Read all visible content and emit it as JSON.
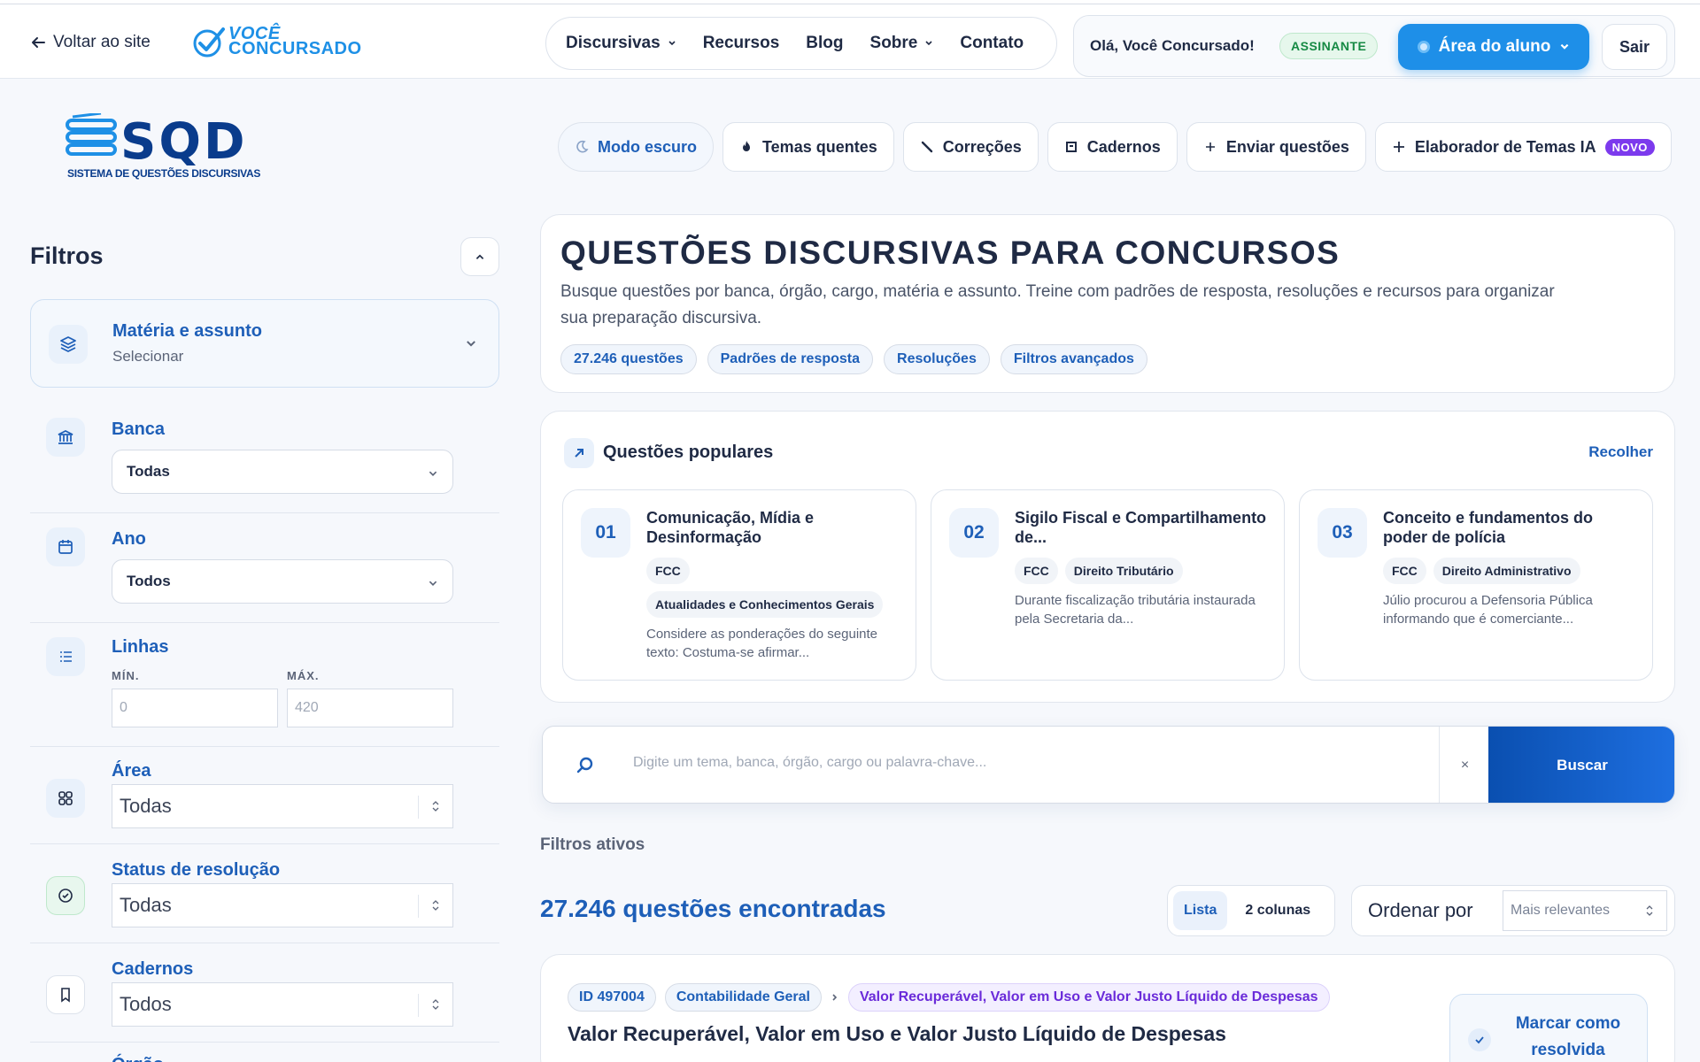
{
  "header": {
    "back_label": "Voltar ao site",
    "logo_line1": "VOCÊ",
    "logo_line2": "CONCURSADO",
    "nav": [
      {
        "label": "Discursivas",
        "has_dropdown": true
      },
      {
        "label": "Recursos",
        "has_dropdown": false
      },
      {
        "label": "Blog",
        "has_dropdown": false
      },
      {
        "label": "Sobre",
        "has_dropdown": true
      },
      {
        "label": "Contato",
        "has_dropdown": false
      }
    ],
    "greeting": "Olá, Você Concursado!",
    "subscriber_badge": "ASSINANTE",
    "student_area": "Área do aluno",
    "logout": "Sair"
  },
  "brand": {
    "title": "SQD",
    "subtitle": "SISTEMA DE QUESTÕES DISCURSIVAS"
  },
  "toolbar": {
    "dark_mode": "Modo escuro",
    "hot_topics": "Temas quentes",
    "corrections": "Correções",
    "notebooks": "Cadernos",
    "send_questions": "Enviar questões",
    "ai_builder": "Elaborador de Temas IA",
    "new_badge": "NOVO"
  },
  "filters": {
    "title": "Filtros",
    "subject": {
      "label": "Matéria e assunto",
      "value": "Selecionar"
    },
    "bank": {
      "label": "Banca",
      "value": "Todas"
    },
    "year": {
      "label": "Ano",
      "value": "Todos"
    },
    "lines": {
      "label": "Linhas",
      "min_label": "MÍN.",
      "max_label": "MÁX.",
      "min_placeholder": "0",
      "max_placeholder": "420"
    },
    "area": {
      "label": "Área",
      "value": "Todas"
    },
    "status": {
      "label": "Status de resolução",
      "value": "Todas"
    },
    "notebooks": {
      "label": "Cadernos",
      "value": "Todos"
    },
    "next_label": "Órgão"
  },
  "hero": {
    "title": "QUESTÕES DISCURSIVAS PARA CONCURSOS",
    "description": "Busque questões por banca, órgão, cargo, matéria e assunto. Treine com padrões de resposta, resoluções e recursos para organizar sua preparação discursiva.",
    "chips": [
      "27.246 questões",
      "Padrões de resposta",
      "Resoluções",
      "Filtros avançados"
    ]
  },
  "popular": {
    "title": "Questões populares",
    "collapse": "Recolher",
    "items": [
      {
        "num": "01",
        "title": "Comunicação, Mídia e Desinformação",
        "tags": [
          "FCC",
          "Atualidades e Conhecimentos Gerais"
        ],
        "snippet": "Considere as ponderações do seguinte texto: Costuma-se afirmar..."
      },
      {
        "num": "02",
        "title": "Sigilo Fiscal e Compartilhamento de...",
        "tags": [
          "FCC",
          "Direito Tributário"
        ],
        "snippet": "Durante fiscalização tributária instaurada pela Secretaria da..."
      },
      {
        "num": "03",
        "title": "Conceito e fundamentos do poder de polícia",
        "tags": [
          "FCC",
          "Direito Administrativo"
        ],
        "snippet": "Júlio procurou a Defensoria Pública informando que é comerciante..."
      }
    ]
  },
  "search": {
    "placeholder": "Digite um tema, banca, órgão, cargo ou palavra-chave...",
    "clear": "×",
    "button": "Buscar"
  },
  "results": {
    "active_filters": "Filtros ativos",
    "count_text": "27.246 questões encontradas",
    "view_list": "Lista",
    "view_two": "2 colunas",
    "order_label": "Ordenar por",
    "order_value": "Mais relevantes"
  },
  "result_card": {
    "id": "ID 497004",
    "subject": "Contabilidade Geral",
    "topic": "Valor Recuperável, Valor em Uso e Valor Justo Líquido de Despesas",
    "title": "Valor Recuperável, Valor em Uso e Valor Justo Líquido de Despesas",
    "resolve_button": "Marcar como resolvida"
  },
  "colors": {
    "primary": "#1e5fb8",
    "accent": "#1e8fe8",
    "success": "#168a44",
    "new": "#7c3aed"
  }
}
